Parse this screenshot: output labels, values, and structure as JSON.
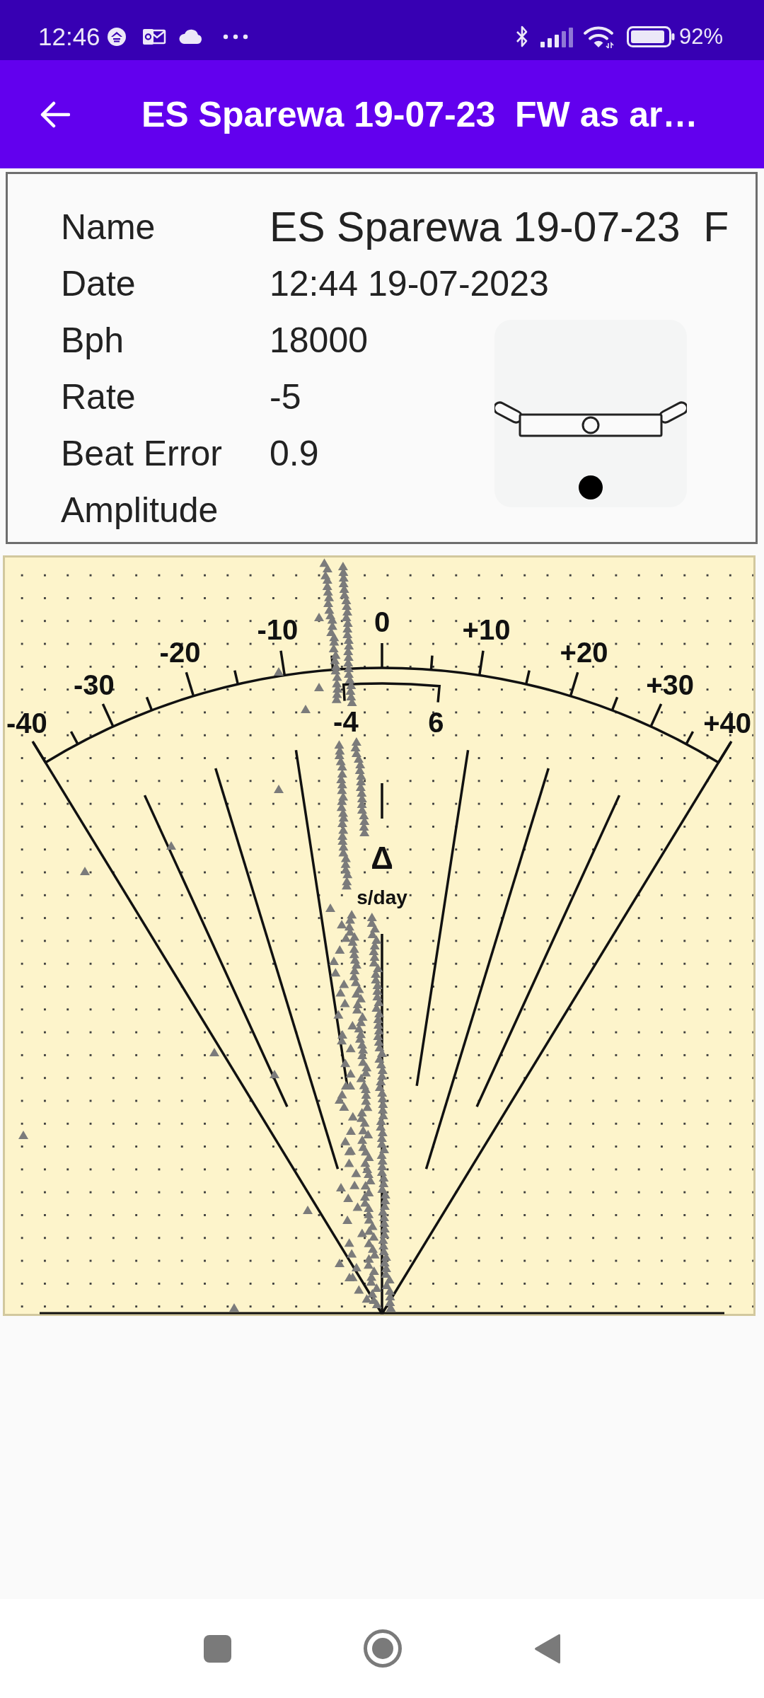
{
  "status_bar": {
    "time": "12:46",
    "battery": "92%"
  },
  "app_bar": {
    "title": "ES Sparewa 19-07-23  FW as ar…"
  },
  "info": {
    "rows": [
      {
        "label": "Name",
        "value": "ES Sparewa 19-07-23  F"
      },
      {
        "label": "Date",
        "value": "12:44 19-07-2023"
      },
      {
        "label": "Bph",
        "value": "18000"
      },
      {
        "label": "Rate",
        "value": "-5"
      },
      {
        "label": "Beat Error",
        "value": "0.9"
      },
      {
        "label": "Amplitude"
      }
    ]
  },
  "dial": {
    "scale_labels": [
      "-40",
      "-30",
      "-20",
      "-10",
      "0",
      "+10",
      "+20",
      "+30",
      "+40"
    ],
    "range_labels": [
      "-4",
      "6"
    ],
    "symbol": "Δ",
    "unit": "s/day"
  }
}
